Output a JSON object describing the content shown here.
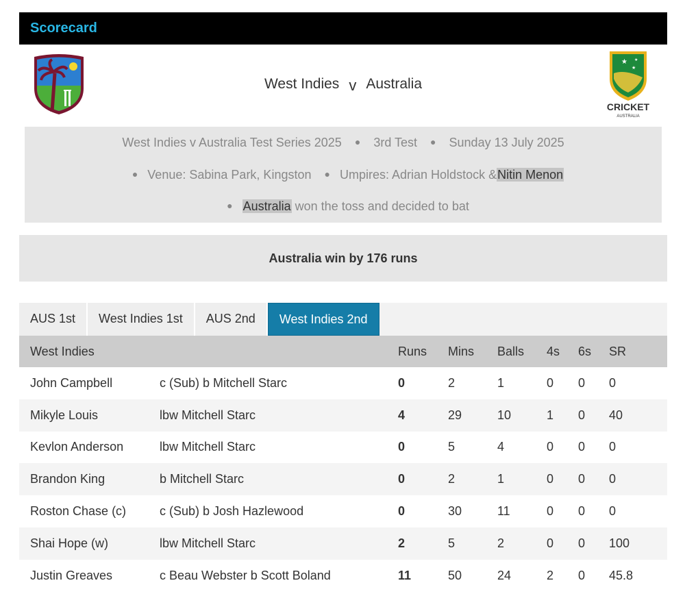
{
  "header": {
    "title": "Scorecard"
  },
  "match": {
    "home_team": "West Indies",
    "vs": "v",
    "away_team": "Australia",
    "series": "West Indies v Australia Test Series 2025",
    "test": "3rd Test",
    "date": "Sunday 13 July 2025",
    "venue_label": "Venue:",
    "venue": "Sabina Park, Kingston",
    "umpires_label": "Umpires:",
    "umpire1": "Adrian Holdstock",
    "umpire_sep": "&",
    "umpire2": "Nitin Menon",
    "toss_team": "Australia",
    "toss_text": "won the toss and decided to bat",
    "result": "Australia win by 176 runs"
  },
  "logos": {
    "away_text": "CRICKET",
    "away_subtext": "AUSTRALIA"
  },
  "colors": {
    "header_bg": "#000000",
    "title": "#29b6e4",
    "active_tab": "#157da8"
  },
  "tabs": [
    {
      "label": "AUS 1st"
    },
    {
      "label": "West Indies 1st"
    },
    {
      "label": "AUS 2nd"
    },
    {
      "label": "West Indies 2nd",
      "active": true
    }
  ],
  "batting": {
    "columns": [
      "West Indies",
      "",
      "Runs",
      "Mins",
      "Balls",
      "4s",
      "6s",
      "SR"
    ],
    "rows": [
      [
        "John Campbell",
        "c (Sub) b Mitchell Starc",
        "0",
        "2",
        "1",
        "0",
        "0",
        "0"
      ],
      [
        "Mikyle Louis",
        "lbw Mitchell Starc",
        "4",
        "29",
        "10",
        "1",
        "0",
        "40"
      ],
      [
        "Kevlon Anderson",
        "lbw Mitchell Starc",
        "0",
        "5",
        "4",
        "0",
        "0",
        "0"
      ],
      [
        "Brandon King",
        "b Mitchell Starc",
        "0",
        "2",
        "1",
        "0",
        "0",
        "0"
      ],
      [
        "Roston Chase (c)",
        "c (Sub) b Josh Hazlewood",
        "0",
        "30",
        "11",
        "0",
        "0",
        "0"
      ],
      [
        "Shai Hope (w)",
        "lbw Mitchell Starc",
        "2",
        "5",
        "2",
        "0",
        "0",
        "100"
      ],
      [
        "Justin Greaves",
        "c Beau Webster b Scott Boland",
        "11",
        "50",
        "24",
        "2",
        "0",
        "45.8"
      ]
    ]
  }
}
